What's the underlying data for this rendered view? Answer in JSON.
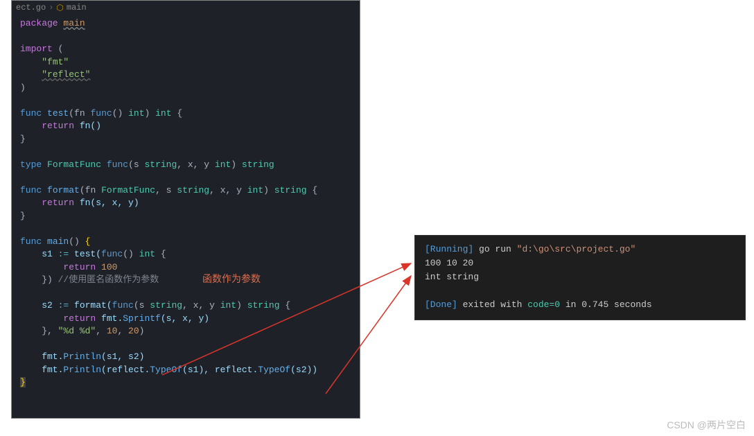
{
  "breadcrumb": {
    "file": "ect.go",
    "symbol": "main"
  },
  "code": {
    "l1a": "package",
    "l1b": "main",
    "l2a": "import",
    "l2b": "(",
    "l3": "\"fmt\"",
    "l4": "\"reflect\"",
    "l5": ")",
    "l6a": "func",
    "l6b": "test",
    "l6c": "(fn ",
    "l6d": "func",
    "l6e": "() ",
    "l6f": "int",
    "l6g": ") ",
    "l6h": "int",
    "l6i": " {",
    "l7a": "return",
    "l7b": " fn()",
    "l8": "}",
    "l9a": "type",
    "l9b": " FormatFunc ",
    "l9c": "func",
    "l9d": "(s ",
    "l9e": "string",
    "l9f": ", x, y ",
    "l9g": "int",
    "l9h": ") ",
    "l9i": "string",
    "l10a": "func",
    "l10b": "format",
    "l10c": "(fn ",
    "l10d": "FormatFunc",
    "l10e": ", s ",
    "l10f": "string",
    "l10g": ", x, y ",
    "l10h": "int",
    "l10i": ") ",
    "l10j": "string",
    "l10k": " {",
    "l11a": "return",
    "l11b": " fn(s, x, y)",
    "l12": "}",
    "l13a": "func",
    "l13b": "main",
    "l13c": "() ",
    "l13d": "{",
    "l14a": "    s1 ",
    "l14b": ":=",
    "l14c": " test(",
    "l14d": "func",
    "l14e": "() ",
    "l14f": "int",
    "l14g": " {",
    "l15a": "return",
    "l15b": "100",
    "l16a": "    }) ",
    "l16b": "//使用匿名函数作为参数",
    "l17a": "    s2 ",
    "l17b": ":=",
    "l17c": " format(",
    "l17d": "func",
    "l17e": "(s ",
    "l17f": "string",
    "l17g": ", x, y ",
    "l17h": "int",
    "l17i": ") ",
    "l17j": "string",
    "l17k": " {",
    "l18a": "return",
    "l18b": " fmt.",
    "l18c": "Sprintf",
    "l18d": "(s, x, y)",
    "l19a": "    }, ",
    "l19b": "\"%d %d\"",
    "l19c": ", ",
    "l19d": "10",
    "l19e": ", ",
    "l19f": "20",
    "l19g": ")",
    "l20a": "    fmt.",
    "l20b": "Println",
    "l20c": "(s1, s2)",
    "l21a": "    fmt.",
    "l21b": "Println",
    "l21c": "(reflect.",
    "l21d": "TypeOf",
    "l21e": "(s1), reflect.",
    "l21f": "TypeOf",
    "l21g": "(s2))",
    "l22": "}"
  },
  "annotation": "函数作为参数",
  "terminal": {
    "running_tag": "[Running]",
    "running_cmd": " go run ",
    "running_path": "\"d:\\go\\src\\project.go\"",
    "out1": "100 10 20",
    "out2": "int string",
    "done_tag": "[Done]",
    "done_txt1": " exited with ",
    "done_code": "code=0",
    "done_txt2": " in 0.745 seconds"
  },
  "watermark": "CSDN @两片空白"
}
